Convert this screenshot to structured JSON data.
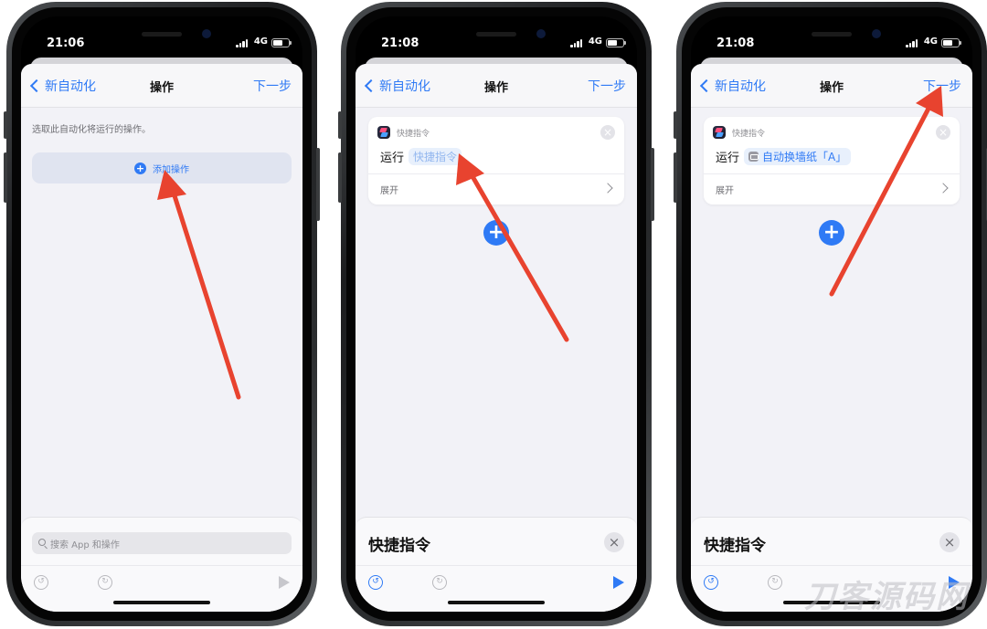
{
  "colors": {
    "accent": "#2f7af5",
    "arrow": "#e8432f",
    "background": "#f2f2f7"
  },
  "screens": [
    {
      "time": "21:06",
      "network": "4G",
      "nav": {
        "back": "新自动化",
        "title": "操作",
        "next": "下一步"
      },
      "hint": "选取此自动化将运行的操作。",
      "add_action": "添加操作",
      "search_placeholder": "搜索 App 和操作"
    },
    {
      "time": "21:08",
      "network": "4G",
      "nav": {
        "back": "新自动化",
        "title": "操作",
        "next": "下一步"
      },
      "card": {
        "app": "快捷指令",
        "run": "运行",
        "token": "快捷指令",
        "expand": "展开"
      },
      "panel_title": "快捷指令"
    },
    {
      "time": "21:08",
      "network": "4G",
      "nav": {
        "back": "新自动化",
        "title": "操作",
        "next": "下一步"
      },
      "card": {
        "app": "快捷指令",
        "run": "运行",
        "token": "自动换墙纸「A」",
        "expand": "展开"
      },
      "panel_title": "快捷指令"
    }
  ],
  "icons": [
    "back-chevron-icon",
    "plus-icon",
    "shortcuts-app-icon",
    "close-icon",
    "chevron-right-icon",
    "search-icon",
    "undo-icon",
    "redo-icon",
    "play-icon",
    "wallpaper-icon"
  ],
  "watermark": "刀客源码网"
}
